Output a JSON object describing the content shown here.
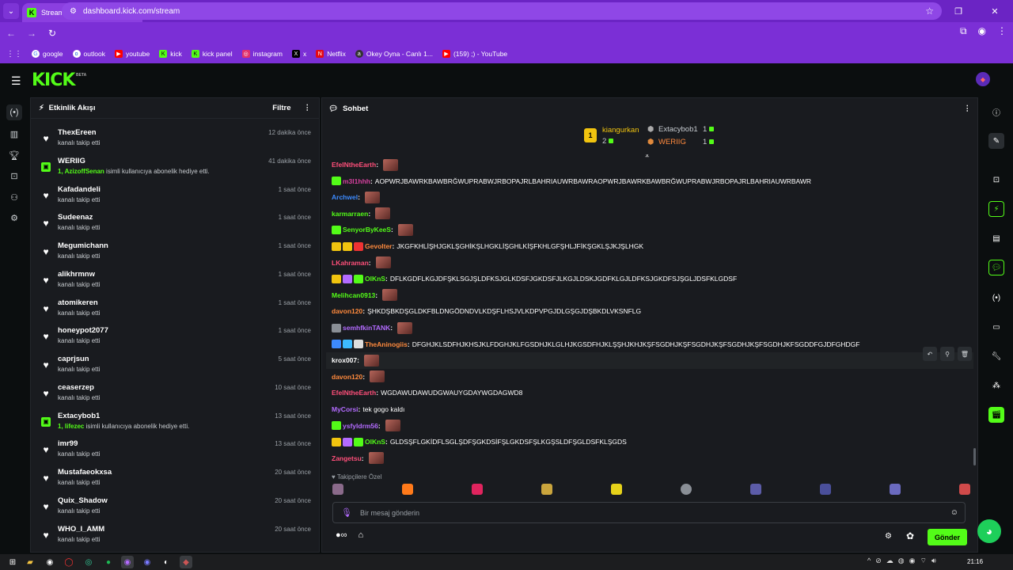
{
  "browser": {
    "tab_title": "Stream - Kick Dashboard",
    "url": "dashboard.kick.com/stream",
    "bookmarks": [
      "google",
      "outlook",
      "youtube",
      "kick",
      "kick panel",
      "instagram",
      "x",
      "Netflix",
      "Okey Oyna - Canlı 1...",
      "(159) ;) - YouTube"
    ]
  },
  "app": {
    "logo": "KICK",
    "logo_badge": "BETA"
  },
  "activity": {
    "title": "Etkinlik Akışı",
    "filter_label": "Filtre",
    "items": [
      {
        "name": "ThexEreen",
        "sub": "kanalı takip etti",
        "time": "12 dakika önce",
        "type": "follow"
      },
      {
        "name": "WERIIG",
        "sub_highlight": "1, AzizoffSenan",
        "sub": " isimli kullanıcıya abonelik hediye etti.",
        "time": "41 dakika önce",
        "type": "gift"
      },
      {
        "name": "Kafadandeli",
        "sub": "kanalı takip etti",
        "time": "1 saat önce",
        "type": "follow"
      },
      {
        "name": "Sudeenaz",
        "sub": "kanalı takip etti",
        "time": "1 saat önce",
        "type": "follow"
      },
      {
        "name": "Megumichann",
        "sub": "kanalı takip etti",
        "time": "1 saat önce",
        "type": "follow"
      },
      {
        "name": "alikhrmnw",
        "sub": "kanalı takip etti",
        "time": "1 saat önce",
        "type": "follow"
      },
      {
        "name": "atomikeren",
        "sub": "kanalı takip etti",
        "time": "1 saat önce",
        "type": "follow"
      },
      {
        "name": "honeypot2077",
        "sub": "kanalı takip etti",
        "time": "1 saat önce",
        "type": "follow"
      },
      {
        "name": "caprjsun",
        "sub": "kanalı takip etti",
        "time": "5 saat önce",
        "type": "follow"
      },
      {
        "name": "ceaserzep",
        "sub": "kanalı takip etti",
        "time": "10 saat önce",
        "type": "follow"
      },
      {
        "name": "Extacybob1",
        "sub_highlight": "1, lifezec",
        "sub": " isimli kullanıcıya abonelik hediye etti.",
        "time": "13 saat önce",
        "type": "gift"
      },
      {
        "name": "imr99",
        "sub": "kanalı takip etti",
        "time": "13 saat önce",
        "type": "follow"
      },
      {
        "name": "Mustafaeokxsa",
        "sub": "kanalı takip etti",
        "time": "20 saat önce",
        "type": "follow"
      },
      {
        "name": "Quix_Shadow",
        "sub": "kanalı takip etti",
        "time": "20 saat önce",
        "type": "follow"
      },
      {
        "name": "WHO_I_AMM",
        "sub": "kanalı takip etti",
        "time": "20 saat önce",
        "type": "follow"
      }
    ]
  },
  "chat": {
    "title": "Sohbet",
    "leaderboard": [
      {
        "rank": "1",
        "name": "kiangurkan",
        "count": "2"
      },
      {
        "name": "Extacybob1",
        "count": "1"
      },
      {
        "name": "WERIIG",
        "count": "1"
      }
    ],
    "messages": [
      {
        "user": "EfeINtheEarth",
        "color": "#ff4f7a",
        "text": "",
        "emote": true,
        "badges": []
      },
      {
        "user": "m3l1hhh",
        "color": "#d6409f",
        "text": "AOPWRJBAWRKBAWBRĞWUPRABWJRBOPAJRLBAHRIAUWRBAWRAOPWRJBAWRKBAWBRĞWUPRABWJRBOPAJRLBAHRIAUWRBAWR",
        "emote": false,
        "badges": [
          "#53fc18"
        ]
      },
      {
        "user": "Archwel",
        "color": "#3d8bff",
        "text": "",
        "emote": true,
        "badges": []
      },
      {
        "user": "karmarraen",
        "color": "#53fc18",
        "text": "",
        "emote": true,
        "badges": []
      },
      {
        "user": "SenyorByKeeS",
        "color": "#53fc18",
        "text": "",
        "emote": true,
        "badges": [
          "#53fc18"
        ]
      },
      {
        "user": "Gevolter",
        "color": "#ff8a3d",
        "text": "JKGFKHLİŞHJGKLŞGHİKŞLHGKLİŞGHLKİŞFKHLGFŞHLJFİKŞGKLŞJKJŞLHGK",
        "emote": false,
        "badges": [
          "#f1c40f",
          "#f1c40f",
          "#e33"
        ]
      },
      {
        "user": "LKahraman",
        "color": "#ff4f7a",
        "text": "",
        "emote": true,
        "badges": []
      },
      {
        "user": "OlKnS",
        "color": "#53fc18",
        "text": "DFLKGDFLKGJDFŞKLSGJŞLDFKSJGLKDSFJGKDSFJLKGJLDSKJGDFKLGJLDFKSJGKDFSJŞGLJDSFKLGDSF",
        "emote": false,
        "badges": [
          "#f1c40f",
          "#b36bff",
          "#53fc18"
        ]
      },
      {
        "user": "Melihcan0913",
        "color": "#53fc18",
        "text": "",
        "emote": true,
        "badges": []
      },
      {
        "user": "davon120",
        "color": "#ff8a3d",
        "text": "ŞHKDŞBKDŞGLDKFBLDNGÖDNDVLKDŞFLHSJVLKDPVPGJDLGŞGJDŞBKDLVKSNFLG",
        "emote": false,
        "badges": []
      },
      {
        "user": "semhfkinTANK",
        "color": "#b36bff",
        "text": "",
        "emote": true,
        "badges": [
          "#8a8f96"
        ]
      },
      {
        "user": "TheAninogiis",
        "color": "#ff8a3d",
        "text": "DFGHJKLSDFHJKHSJKLFDGHJKLFGSDHJKLGLHJKGSDFHJKLŞŞHJKHJKŞFSGDHJKŞFSGDHJKŞFSGDHJKŞFSGDHJKFSGDDFGJDFGHDGF",
        "emote": false,
        "badges": [
          "#3d8bff",
          "#3dbbff",
          "#ddd"
        ]
      },
      {
        "user": "krox007",
        "color": "#ffffff",
        "text": "",
        "emote": true,
        "badges": []
      },
      {
        "user": "davon120",
        "color": "#ff8a3d",
        "text": "",
        "emote": true,
        "badges": []
      },
      {
        "user": "EfeINtheEarth",
        "color": "#ff4f7a",
        "text": "WGDAWUDAWUDGWAUYGDAYWGDAGWD8",
        "emote": false,
        "badges": []
      },
      {
        "user": "MyCorsi",
        "color": "#b36bff",
        "text": "tek gogo kaldı",
        "emote": false,
        "badges": []
      },
      {
        "user": "ysfyldrm56",
        "color": "#b36bff",
        "text": "",
        "emote": true,
        "badges": [
          "#53fc18"
        ]
      },
      {
        "user": "OlKnS",
        "color": "#53fc18",
        "text": "GLDSŞFLGKİDFLSGLŞDFŞGKDSİFŞLGKDSFŞLKGŞSLDFŞGLDSFKLŞGDS",
        "emote": false,
        "badges": [
          "#f1c40f",
          "#b36bff",
          "#53fc18"
        ]
      },
      {
        "user": "Zangetsu",
        "color": "#ff4f7a",
        "text": "",
        "emote": true,
        "badges": []
      }
    ],
    "pinned_label": "Takipçilere Özel",
    "input_placeholder": "Bir mesaj gönderin",
    "send_label": "Gönder"
  },
  "taskbar": {
    "time": "21:16"
  }
}
